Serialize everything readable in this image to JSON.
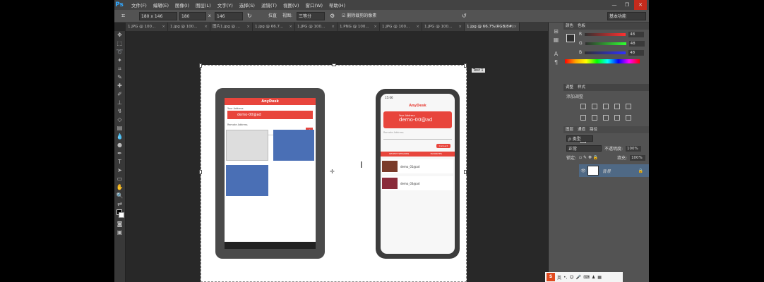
{
  "menu": {
    "logo": "Ps",
    "items": [
      "文件(F)",
      "编辑(E)",
      "图像(I)",
      "图层(L)",
      "文字(Y)",
      "选择(S)",
      "滤镜(T)",
      "视图(V)",
      "窗口(W)",
      "帮助(H)"
    ]
  },
  "window_controls": {
    "minimize": "—",
    "restore": "❐",
    "close": "✕"
  },
  "options": {
    "size": "180 x 146",
    "width": "180",
    "x_sep": "x",
    "height": "146",
    "unit_label": "拉直",
    "view_label": "视图:",
    "view_value": "三等分",
    "delete_label": "删除裁剪的像素",
    "workspace": "基本功能"
  },
  "tabs": [
    "1.JPG @ 100...",
    "1.jpg @ 100...",
    "图片1.jpg @ ...",
    "1.jpg @ 66.7...",
    "1.JPG @ 100...",
    "1.PNG @ 100...",
    "1.JPG @ 100...",
    "1.JPG @ 100...",
    "1.jpg @ 66.7%(RGB/8#)"
  ],
  "canvas": {
    "cursor_label": "Test 1"
  },
  "tablet": {
    "app": "AnyDesk",
    "your_address": "Your Address",
    "address": "demo-00@ad",
    "remote_address": "Remote Address"
  },
  "phone": {
    "time": "15:06",
    "app": "AnyDesk",
    "your_address": "Your Address",
    "address": "demo-00@ad",
    "remote_address": "Remote Address",
    "connect": "Connect",
    "tab_recent": "RECENT SESSIONS",
    "tab_fav": "FAVORITES",
    "session1": "demo_01@ad",
    "session2": "demo_03@ad"
  },
  "panels": {
    "color_tab": "颜色",
    "swatch_tab": "色板",
    "r_label": "R",
    "g_label": "G",
    "b_label": "B",
    "r": "48",
    "g": "48",
    "b": "48",
    "adjust_tab": "调整",
    "style_tab": "样式",
    "add_adjust": "添加调整",
    "layers_tab": "图层",
    "channels_tab": "通道",
    "paths_tab": "路径",
    "kind": "ρ 类型",
    "mode": "正常",
    "opacity_label": "不透明度:",
    "opacity": "100%",
    "lock_label": "锁定:",
    "fill_label": "填充:",
    "fill": "100%",
    "layer_name": "背景"
  },
  "ime": {
    "logo": "S",
    "lang": "英"
  }
}
